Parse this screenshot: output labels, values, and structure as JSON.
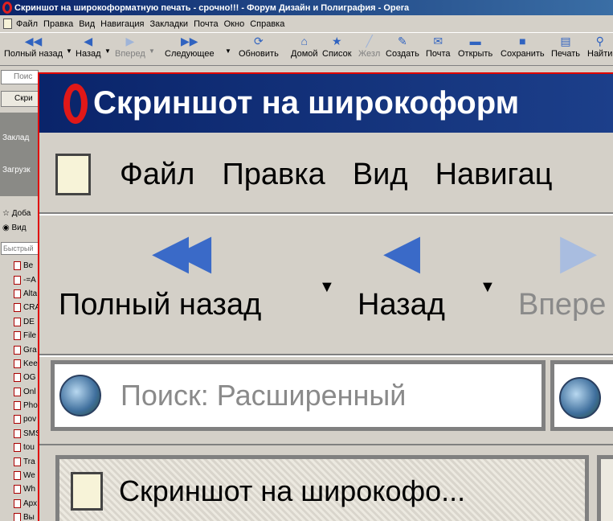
{
  "window": {
    "title": "Скриншот на широкоформатную печать - срочно!!! - Форум Дизайн и Полиграфия - Opera"
  },
  "menu": [
    "Файл",
    "Правка",
    "Вид",
    "Навигация",
    "Закладки",
    "Почта",
    "Окно",
    "Справка"
  ],
  "toolbar": {
    "buttons": [
      {
        "label": "Полный назад",
        "icon": "rewind-icon",
        "enabled": true
      },
      {
        "label": "Назад",
        "icon": "back-arrow-icon",
        "enabled": true
      },
      {
        "label": "Вперед",
        "icon": "forward-arrow-icon",
        "enabled": false
      },
      {
        "label": "Следующее",
        "icon": "fast-forward-icon",
        "enabled": true
      },
      {
        "label": "Обновить",
        "icon": "reload-icon",
        "enabled": true
      },
      {
        "label": "Домой",
        "icon": "home-icon",
        "enabled": true
      },
      {
        "label": "Список",
        "icon": "star-icon",
        "enabled": true
      },
      {
        "label": "Жезл",
        "icon": "wand-icon",
        "enabled": false
      },
      {
        "label": "Создать",
        "icon": "new-page-icon",
        "enabled": true
      },
      {
        "label": "Почта",
        "icon": "mail-icon",
        "enabled": true
      },
      {
        "label": "Открыть",
        "icon": "folder-icon",
        "enabled": true
      },
      {
        "label": "Сохранить",
        "icon": "save-icon",
        "enabled": true
      },
      {
        "label": "Печать",
        "icon": "printer-icon",
        "enabled": true
      },
      {
        "label": "Найти",
        "icon": "find-icon",
        "enabled": true
      }
    ]
  },
  "panel": {
    "search_text": "Поис",
    "tab_text": "Скри",
    "bookmarks_label": "Заклад",
    "downloads_label": "Загрузк",
    "add_label": "Доба",
    "view_label": "Вид",
    "filter_placeholder": "Быстрый",
    "items": [
      "Be",
      "-=A",
      "Alta",
      "CRA",
      "DE",
      "File",
      "Gra",
      "Kee",
      "OG",
      "Onl",
      "Pho",
      "pov",
      "SMS",
      "tou",
      "Tra",
      "We",
      "Wh",
      "Арх",
      "Вы"
    ]
  },
  "zoom": {
    "title": "Скриншот на широкоформ",
    "menu": [
      "Файл",
      "Правка",
      "Вид",
      "Навигац"
    ],
    "buttons": [
      "Полный назад",
      "Назад",
      "Впере"
    ],
    "search_placeholder": "Поиск: Расширенный",
    "tab_title": "Скриншот на широкофо..."
  },
  "colors": {
    "title_bar": "#0a246a",
    "chrome": "#d4d0c8",
    "highlight_border": "#e00000",
    "icon_blue": "#3063c0"
  }
}
